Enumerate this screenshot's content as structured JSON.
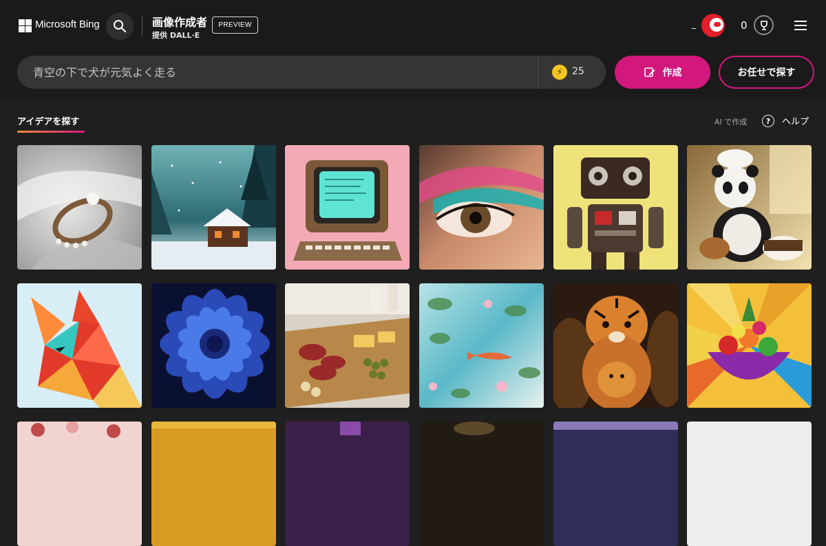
{
  "header": {
    "brand": "Microsoft Bing",
    "app_title": "画像作成者",
    "provider": "提供 DALL·E",
    "preview_badge": "PREVIEW",
    "user_name": "_",
    "reward_count": "0",
    "icons": {
      "logo": "microsoft-logo",
      "search": "search-icon",
      "avatar": "avatar",
      "rewards": "trophy-icon",
      "menu": "hamburger-menu-icon"
    }
  },
  "prompt": {
    "placeholder": "青空の下で犬が元気よく走る",
    "boost_count": "25",
    "create_label": "作成",
    "surprise_label": "お任せで探す"
  },
  "tabs": {
    "explore_label": "アイデアを探す",
    "ai_link": "AI で作成",
    "help_label": "ヘルプ"
  },
  "gallery": {
    "tiles": [
      {
        "subject": "pearl-ring",
        "colors": [
          "#d6d6d4",
          "#7a6a5a"
        ]
      },
      {
        "subject": "snowy-cabin",
        "colors": [
          "#2e6f78",
          "#b94f2a"
        ]
      },
      {
        "subject": "retro-computer",
        "colors": [
          "#f5a7b3",
          "#5fe0d1"
        ]
      },
      {
        "subject": "eye-makeup",
        "colors": [
          "#d9a07c",
          "#1aa3a8"
        ]
      },
      {
        "subject": "robot",
        "colors": [
          "#e8dc6a",
          "#c0262a"
        ]
      },
      {
        "subject": "panda-chef",
        "colors": [
          "#c9a96a",
          "#f0e6d0"
        ]
      },
      {
        "subject": "paper-wolf",
        "colors": [
          "#cfe9f2",
          "#e2452f"
        ]
      },
      {
        "subject": "blue-dahlia",
        "colors": [
          "#101a4a",
          "#3a6fd8"
        ]
      },
      {
        "subject": "charcuterie",
        "colors": [
          "#e8e2d8",
          "#8a2a2a"
        ]
      },
      {
        "subject": "koi-pond",
        "colors": [
          "#6ec9d6",
          "#e46a3a"
        ]
      },
      {
        "subject": "tiger-figures",
        "colors": [
          "#2a1a10",
          "#d9812e"
        ]
      },
      {
        "subject": "fruit-bowl",
        "colors": [
          "#f5c43a",
          "#d62a2a"
        ]
      },
      {
        "subject": "floral",
        "colors": [
          "#f1d4d0",
          "#c04a4a"
        ]
      },
      {
        "subject": "golden",
        "colors": [
          "#e0a62a",
          "#7a4a10"
        ]
      },
      {
        "subject": "violet",
        "colors": [
          "#4a2a5a",
          "#8a4aa8"
        ]
      },
      {
        "subject": "dark",
        "colors": [
          "#2a221a",
          "#6a5a3a"
        ]
      },
      {
        "subject": "purple-haze",
        "colors": [
          "#3a3a6a",
          "#c08ab0"
        ]
      },
      {
        "subject": "light",
        "colors": [
          "#efefef",
          "#cfcfcf"
        ]
      }
    ]
  }
}
